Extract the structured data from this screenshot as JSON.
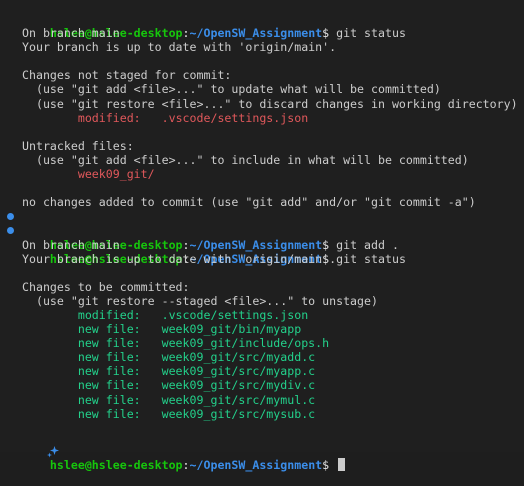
{
  "prompt": {
    "user_host": "hslee@hslee-desktop",
    "sep": ":",
    "path": "~/OpenSW_Assignment",
    "symbol": "$"
  },
  "commands": [
    "git status",
    "git add .",
    "git status"
  ],
  "out1": {
    "l1": "On branch main",
    "l2": "Your branch is up to date with 'origin/main'.",
    "l3": "Changes not staged for commit:",
    "l4": "  (use \"git add <file>...\" to update what will be committed)",
    "l5": "  (use \"git restore <file>...\" to discard changes in working directory)",
    "l6_label": "        modified:   ",
    "l6_file": ".vscode/settings.json",
    "l7": "Untracked files:",
    "l8": "  (use \"git add <file>...\" to include in what will be committed)",
    "l9_indent": "        ",
    "l9_file": "week09_git/",
    "l10": "no changes added to commit (use \"git add\" and/or \"git commit -a\")"
  },
  "out2": {
    "l1": "On branch main",
    "l2": "Your branch is up to date with 'origin/main'.",
    "l3": "Changes to be committed:",
    "l4": "  (use \"git restore --staged <file>...\" to unstage)",
    "staged": [
      "        modified:   .vscode/settings.json",
      "        new file:   week09_git/bin/myapp",
      "        new file:   week09_git/include/ops.h",
      "        new file:   week09_git/src/myadd.c",
      "        new file:   week09_git/src/myapp.c",
      "        new file:   week09_git/src/mydiv.c",
      "        new file:   week09_git/src/mymul.c",
      "        new file:   week09_git/src/mysub.c"
    ]
  },
  "icons": {
    "decoration": "circle-dot-icon",
    "current": "sparkle-icon"
  },
  "colors": {
    "background": "#1f1f1f",
    "user": "#16c60c",
    "path": "#3b8eea",
    "red": "#e0585b",
    "green": "#23d18b"
  }
}
